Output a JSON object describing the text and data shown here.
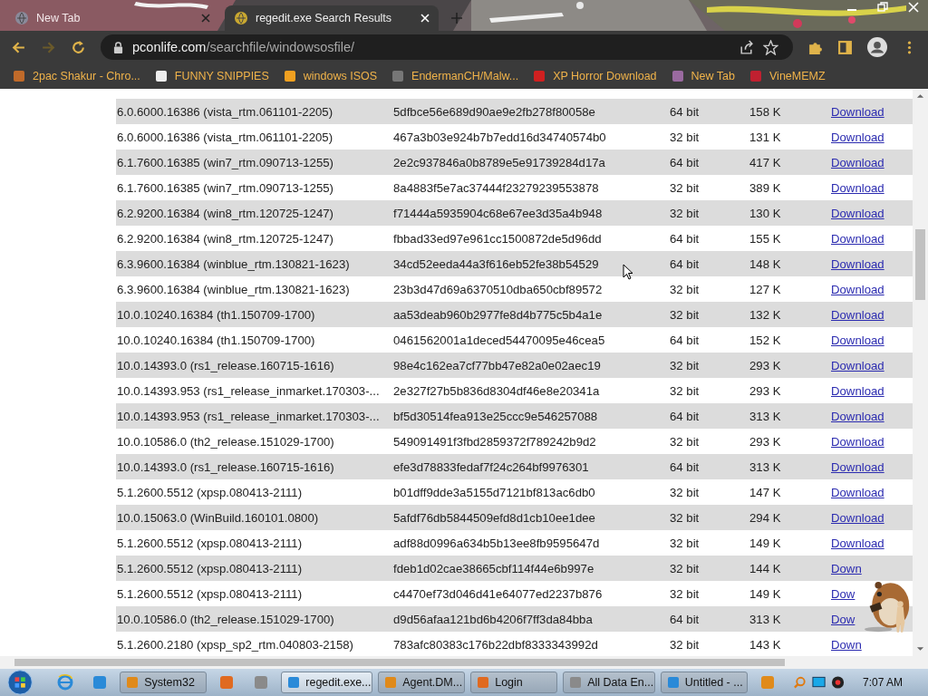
{
  "tabs": [
    {
      "title": "New Tab",
      "selected": false
    },
    {
      "title": "regedit.exe Search Results",
      "selected": true
    }
  ],
  "address_bar": {
    "host": "pconlife.com",
    "path": "/searchfile/windowsosfile/"
  },
  "bookmarks": [
    "2pac Shakur - Chro...",
    "FUNNY SNIPPIES",
    "windows ISOS",
    "EndermanCH/Malw...",
    "XP Horror Download",
    "New Tab",
    "VineMEMZ"
  ],
  "table": {
    "rows": [
      {
        "version": "6.0.6000.16386 (vista_rtm.061101-2205)",
        "hash": "5dfbce56e689d90ae9e2fb278f80058e",
        "bits": "64 bit",
        "size": "158 K",
        "link": "Download"
      },
      {
        "version": "6.0.6000.16386 (vista_rtm.061101-2205)",
        "hash": "467a3b03e924b7b7edd16d34740574b0",
        "bits": "32 bit",
        "size": "131 K",
        "link": "Download"
      },
      {
        "version": "6.1.7600.16385 (win7_rtm.090713-1255)",
        "hash": "2e2c937846a0b8789e5e91739284d17a",
        "bits": "64 bit",
        "size": "417 K",
        "link": "Download"
      },
      {
        "version": "6.1.7600.16385 (win7_rtm.090713-1255)",
        "hash": "8a4883f5e7ac37444f23279239553878",
        "bits": "32 bit",
        "size": "389 K",
        "link": "Download"
      },
      {
        "version": "6.2.9200.16384 (win8_rtm.120725-1247)",
        "hash": "f71444a5935904c68e67ee3d35a4b948",
        "bits": "32 bit",
        "size": "130 K",
        "link": "Download"
      },
      {
        "version": "6.2.9200.16384 (win8_rtm.120725-1247)",
        "hash": "fbbad33ed97e961cc1500872de5d96dd",
        "bits": "64 bit",
        "size": "155 K",
        "link": "Download"
      },
      {
        "version": "6.3.9600.16384 (winblue_rtm.130821-1623)",
        "hash": "34cd52eeda44a3f616eb52fe38b54529",
        "bits": "64 bit",
        "size": "148 K",
        "link": "Download"
      },
      {
        "version": "6.3.9600.16384 (winblue_rtm.130821-1623)",
        "hash": "23b3d47d69a6370510dba650cbf89572",
        "bits": "32 bit",
        "size": "127 K",
        "link": "Download"
      },
      {
        "version": "10.0.10240.16384 (th1.150709-1700)",
        "hash": "aa53deab960b2977fe8d4b775c5b4a1e",
        "bits": "32 bit",
        "size": "132 K",
        "link": "Download"
      },
      {
        "version": "10.0.10240.16384 (th1.150709-1700)",
        "hash": "0461562001a1deced54470095e46cea5",
        "bits": "64 bit",
        "size": "152 K",
        "link": "Download"
      },
      {
        "version": "10.0.14393.0 (rs1_release.160715-1616)",
        "hash": "98e4c162ea7cf77bb47e82a0e02aec19",
        "bits": "32 bit",
        "size": "293 K",
        "link": "Download"
      },
      {
        "version": "10.0.14393.953 (rs1_release_inmarket.170303-...",
        "hash": "2e327f27b5b836d8304df46e8e20341a",
        "bits": "32 bit",
        "size": "293 K",
        "link": "Download"
      },
      {
        "version": "10.0.14393.953 (rs1_release_inmarket.170303-...",
        "hash": "bf5d30514fea913e25ccc9e546257088",
        "bits": "64 bit",
        "size": "313 K",
        "link": "Download"
      },
      {
        "version": "10.0.10586.0 (th2_release.151029-1700)",
        "hash": "549091491f3fbd2859372f789242b9d2",
        "bits": "32 bit",
        "size": "293 K",
        "link": "Download"
      },
      {
        "version": "10.0.14393.0 (rs1_release.160715-1616)",
        "hash": "efe3d78833fedaf7f24c264bf9976301",
        "bits": "64 bit",
        "size": "313 K",
        "link": "Download"
      },
      {
        "version": "5.1.2600.5512 (xpsp.080413-2111)",
        "hash": "b01dff9dde3a5155d7121bf813ac6db0",
        "bits": "32 bit",
        "size": "147 K",
        "link": "Download"
      },
      {
        "version": "10.0.15063.0 (WinBuild.160101.0800)",
        "hash": "5afdf76db5844509efd8d1cb10ee1dee",
        "bits": "32 bit",
        "size": "294 K",
        "link": "Download"
      },
      {
        "version": "5.1.2600.5512 (xpsp.080413-2111)",
        "hash": "adf88d0996a634b5b13ee8fb9595647d",
        "bits": "32 bit",
        "size": "149 K",
        "link": "Download"
      },
      {
        "version": "5.1.2600.5512 (xpsp.080413-2111)",
        "hash": "fdeb1d02cae38665cbf114f44e6b997e",
        "bits": "32 bit",
        "size": "144 K",
        "link": "Down"
      },
      {
        "version": "5.1.2600.5512 (xpsp.080413-2111)",
        "hash": "c4470ef73d046d41e64077ed2237b876",
        "bits": "32 bit",
        "size": "149 K",
        "link": "Dow"
      },
      {
        "version": "10.0.10586.0 (th2_release.151029-1700)",
        "hash": "d9d56afaa121bd6b4206f7ff3da84bba",
        "bits": "64 bit",
        "size": "313 K",
        "link": "Dow"
      },
      {
        "version": "5.1.2600.2180 (xpsp_sp2_rtm.040803-2158)",
        "hash": "783afc80383c176b22dbf8333343992d",
        "bits": "32 bit",
        "size": "143 K",
        "link": "Down"
      }
    ]
  },
  "taskbar": {
    "items": [
      {
        "kind": "icon"
      },
      {
        "kind": "button",
        "label": "System32",
        "selected": false
      },
      {
        "kind": "icon"
      },
      {
        "kind": "icon"
      },
      {
        "kind": "button",
        "label": "regedit.exe...",
        "selected": true
      },
      {
        "kind": "button",
        "label": "Agent.DM...",
        "selected": false
      },
      {
        "kind": "button",
        "label": "Login",
        "selected": false
      },
      {
        "kind": "button",
        "label": "All Data En...",
        "selected": false
      },
      {
        "kind": "button",
        "label": "Untitled - ...",
        "selected": false
      },
      {
        "kind": "icon"
      }
    ],
    "clock": "7:07 AM"
  }
}
